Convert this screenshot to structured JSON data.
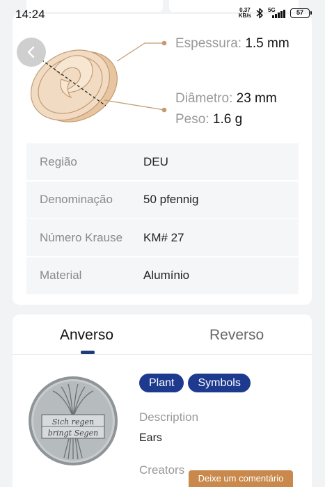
{
  "status_bar": {
    "time": "14:24",
    "net_speed_value": "0,37",
    "net_speed_unit": "KB/s",
    "network": "5G",
    "battery": "57"
  },
  "coin_specs": {
    "thickness_label": "Espessura:",
    "thickness_value": "1.5 mm",
    "diameter_label": "Diâmetro:",
    "diameter_value": "23 mm",
    "weight_label": "Peso:",
    "weight_value": "1.6 g"
  },
  "details": [
    {
      "key": "Região",
      "value": "DEU"
    },
    {
      "key": "Denominação",
      "value": "50 pfennig"
    },
    {
      "key": "Número Krause",
      "value": "KM# 27"
    },
    {
      "key": "Material",
      "value": "Alumínio"
    }
  ],
  "tabs": {
    "active": "Anverso",
    "inactive": "Reverso"
  },
  "obverse": {
    "tags": [
      "Plant",
      "Symbols"
    ],
    "description_label": "Description",
    "description_value": "Ears",
    "creators_label": "Creators",
    "coin_inscription_line1": "Sich regen",
    "coin_inscription_line2": "bringt Segen"
  },
  "comment_button_label": "Deixe um comentário",
  "colors": {
    "accent_navy": "#1e3a8f",
    "comment_button": "#c9894c",
    "coin_gold": "#f1dcc3"
  }
}
